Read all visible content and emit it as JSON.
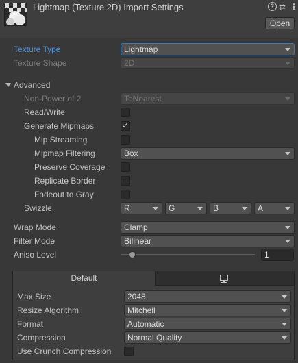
{
  "header": {
    "title": "Lightmap (Texture 2D) Import Settings",
    "open_label": "Open",
    "help_icon": "?",
    "settings_icon": "⇄",
    "menu_icon": "⋮"
  },
  "texture_type": {
    "label": "Texture Type",
    "value": "Lightmap"
  },
  "texture_shape": {
    "label": "Texture Shape",
    "value": "2D"
  },
  "advanced": {
    "label": "Advanced",
    "non_power_of_2": {
      "label": "Non-Power of 2",
      "value": "ToNearest"
    },
    "read_write": {
      "label": "Read/Write",
      "checked": false
    },
    "generate_mipmaps": {
      "label": "Generate Mipmaps",
      "checked": true,
      "mark": "✓"
    },
    "mip_streaming": {
      "label": "Mip Streaming",
      "checked": false
    },
    "mipmap_filtering": {
      "label": "Mipmap Filtering",
      "value": "Box"
    },
    "preserve_coverage": {
      "label": "Preserve Coverage",
      "checked": false
    },
    "replicate_border": {
      "label": "Replicate Border",
      "checked": false
    },
    "fadeout_to_gray": {
      "label": "Fadeout to Gray",
      "checked": false
    },
    "swizzle": {
      "label": "Swizzle",
      "r": "R",
      "g": "G",
      "b": "B",
      "a": "A"
    }
  },
  "wrap_mode": {
    "label": "Wrap Mode",
    "value": "Clamp"
  },
  "filter_mode": {
    "label": "Filter Mode",
    "value": "Bilinear"
  },
  "aniso_level": {
    "label": "Aniso Level",
    "value": "1"
  },
  "platform": {
    "tab_default": "Default",
    "max_size": {
      "label": "Max Size",
      "value": "2048"
    },
    "resize_algorithm": {
      "label": "Resize Algorithm",
      "value": "Mitchell"
    },
    "format": {
      "label": "Format",
      "value": "Automatic"
    },
    "compression": {
      "label": "Compression",
      "value": "Normal Quality"
    },
    "use_crunch": {
      "label": "Use Crunch Compression",
      "checked": false
    }
  },
  "colors": {
    "accent": "#4e96e2",
    "background": "#383838"
  }
}
